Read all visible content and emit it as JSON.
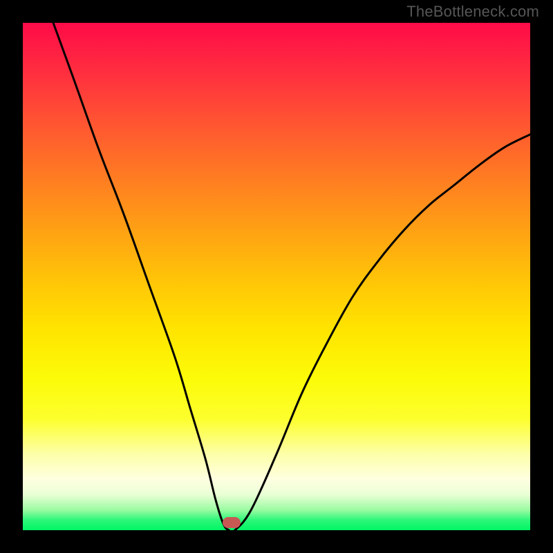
{
  "attribution": "TheBottleneck.com",
  "chart_data": {
    "type": "line",
    "title": "",
    "xlabel": "",
    "ylabel": "",
    "xlim": [
      0,
      100
    ],
    "ylim": [
      0,
      100
    ],
    "series": [
      {
        "name": "bottleneck-curve",
        "x": [
          6,
          10,
          15,
          20,
          25,
          30,
          33,
          36,
          38,
          39.5,
          40.6,
          41.8,
          45,
          50,
          55,
          60,
          65,
          70,
          75,
          80,
          85,
          90,
          95,
          100
        ],
        "values": [
          100,
          89,
          75,
          62,
          48,
          34,
          24,
          14,
          6,
          1.3,
          0,
          0,
          4,
          15,
          27,
          37,
          46,
          53,
          59,
          64,
          68,
          72,
          75.5,
          78
        ]
      }
    ],
    "marker": {
      "x": 41.2,
      "y": 1.5
    },
    "flat_segment": {
      "x0": 40.6,
      "x1": 41.8,
      "y": 0
    },
    "colors": {
      "gradient_top": "#ff0b48",
      "gradient_bottom": "#00f564",
      "curve": "#000000",
      "marker": "#c75955",
      "frame": "#000000"
    }
  }
}
